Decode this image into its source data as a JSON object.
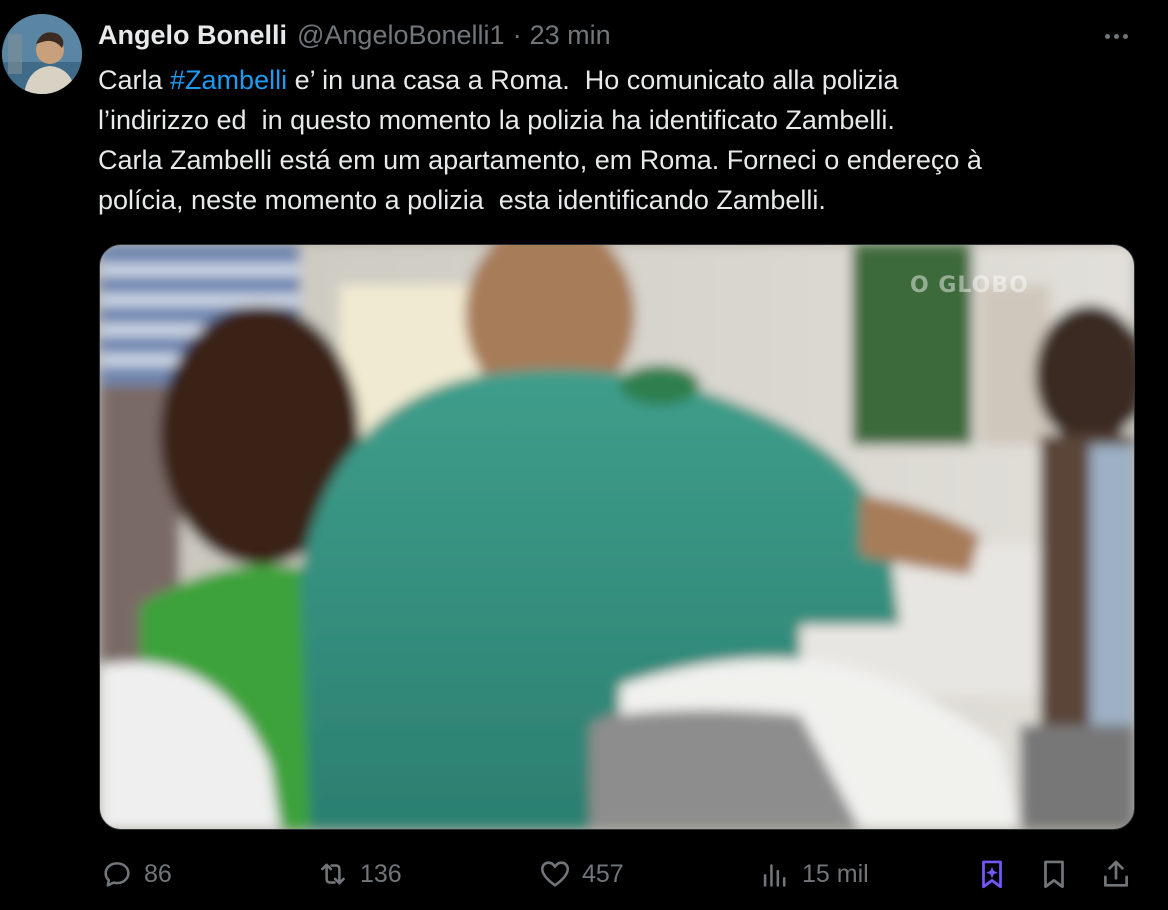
{
  "author": {
    "display_name": "Angelo Bonelli",
    "handle": "@AngeloBonelli1",
    "separator": "·",
    "time": "23 min"
  },
  "tweet": {
    "line1_prefix": "Carla ",
    "hashtag": "#Zambelli",
    "line1_suffix": " e’ in una casa a Roma.  Ho comunicato alla polizia",
    "line2": "l’indirizzo ed  in questo momento la polizia ha identificato Zambelli.",
    "line3": "Carla Zambelli está em um apartamento, em Roma. Forneci o endereço à",
    "line4": "polícia, neste momento a polizia  esta identificando Zambelli."
  },
  "media": {
    "watermark": "O GLOBO"
  },
  "actions": {
    "replies": "86",
    "reposts": "136",
    "likes": "457",
    "views": "15 mil"
  },
  "icons": {
    "more": "more-horizontal-icon",
    "reply": "reply-icon",
    "repost": "repost-icon",
    "like": "heart-icon",
    "views": "views-icon",
    "grok": "grok-icon",
    "bookmark": "bookmark-icon",
    "share": "share-icon"
  },
  "colors": {
    "background": "#000000",
    "text": "#e7e9ea",
    "muted": "#71767b",
    "link": "#1d9bf0",
    "grok_accent": "#7856ff"
  }
}
